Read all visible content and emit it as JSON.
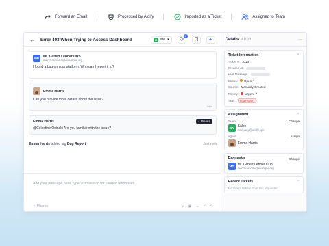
{
  "flow": {
    "steps": [
      {
        "label": "Forward an Email",
        "icon": "forward-arrow-icon"
      },
      {
        "label": "Processed by Aidify",
        "icon": "shield-icon"
      },
      {
        "label": "Imported as a Ticket",
        "icon": "check-circle-icon"
      },
      {
        "label": "Assigned to Team",
        "icon": "team-icon"
      }
    ]
  },
  "header": {
    "title": "Error 403 When Trying to Access Dashboard",
    "assignee_label": "Me",
    "assignee_initials": "M",
    "tag_count": "1"
  },
  "messages": [
    {
      "name": "Mr. Gilbert Lehner DDS",
      "email": "mertz.ramona@example.org",
      "initials": "MD",
      "body": "I found a bug on your platform. Who can I report it to?"
    },
    {
      "name": "Emma Harris",
      "body": "Can you provide more details about the issue?",
      "status": "Sent"
    },
    {
      "name": "Emma Harris",
      "private_label": "Private",
      "body": "@Celestine Osinski Are you familiar with the issue?"
    }
  ],
  "activity": {
    "actor": "Emma Harris",
    "action": "added tag",
    "tag": "Bug Report",
    "time": "Just now"
  },
  "reply": {
    "placeholder": "Add your message here, type '#' to search for canned responses.",
    "macros_label": "Macros"
  },
  "details": {
    "title": "Details",
    "ticket_id": "#1013",
    "ticket_info": {
      "title": "Ticket Information",
      "ticket_label": "Ticket #:",
      "ticket_value": "1013",
      "created_label": "Created At:",
      "updated_label": "Last Message:",
      "status_label": "Status:",
      "status_value": "Open",
      "source_label": "Source:",
      "source_value": "Manually Created",
      "priority_label": "Priority:",
      "priority_value": "Urgent",
      "tags_label": "Tags:",
      "tag_value": "Bug Report"
    },
    "assignment": {
      "title": "Assignment",
      "team_label": "Team",
      "change_label": "Change",
      "team_name": "Sales",
      "team_email": "company@aidify.app",
      "team_initials": "SA",
      "agent_label": "Agent",
      "assign_label": "Assign",
      "agent_name": "Emma Harris"
    },
    "requester": {
      "title": "Requester",
      "change_label": "Change",
      "initials": "MD",
      "name": "Mr. Gilbert Lehner DDS",
      "email": "mertz.ramona@example.org"
    },
    "recent": {
      "title": "Recent Tickets",
      "empty_text": "No recent tickets from this requester"
    }
  },
  "colors": {
    "accent": "#3b6cf4",
    "status_open": "#f08a24",
    "priority_urgent": "#e23b3b",
    "team_avatar": "#27ae60"
  }
}
